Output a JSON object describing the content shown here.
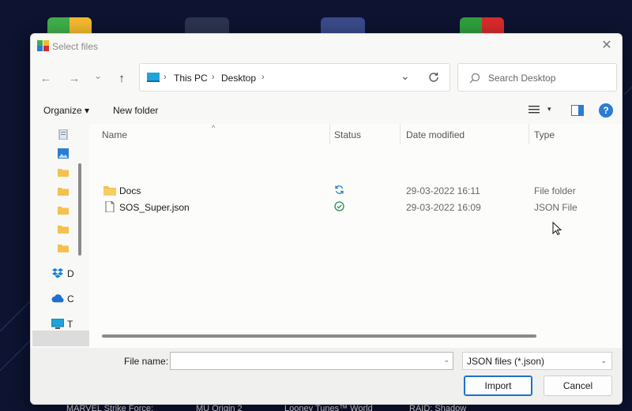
{
  "desktop": {
    "labels": [
      "MARVEL Strike Force:",
      "MU Origin 2",
      "Looney Tunes™ World",
      "RAID: Shadow"
    ]
  },
  "dialog": {
    "title": "Select files",
    "close_symbol": "✕"
  },
  "nav": {
    "back_symbol": "←",
    "forward_symbol": "→",
    "recent_symbol": "⌄",
    "up_symbol": "↑"
  },
  "address": {
    "crumbs": [
      "This PC",
      "Desktop"
    ],
    "separator": "›",
    "dropdown_symbol": "⌄"
  },
  "search": {
    "placeholder": "Search Desktop"
  },
  "toolbar": {
    "organize_label": "Organize ▾",
    "new_folder_label": "New folder",
    "view_drop_symbol": "▾",
    "help_symbol": "?"
  },
  "navpane": {
    "items": [
      {
        "icon": "document-icon",
        "label": ""
      },
      {
        "icon": "pictures-icon",
        "label": ""
      },
      {
        "icon": "folder-icon",
        "label": ""
      },
      {
        "icon": "folder-icon",
        "label": ""
      },
      {
        "icon": "folder-icon",
        "label": ""
      },
      {
        "icon": "folder-icon",
        "label": ""
      },
      {
        "icon": "folder-icon",
        "label": ""
      },
      {
        "icon": "dropbox-icon",
        "label": "D"
      },
      {
        "icon": "onedrive-icon",
        "label": "C"
      },
      {
        "icon": "this-pc-icon",
        "label": "T"
      },
      {
        "icon": "desktop-icon",
        "label": ""
      }
    ]
  },
  "files": {
    "columns": {
      "name": "Name",
      "status": "Status",
      "date": "Date modified",
      "type": "Type"
    },
    "sort_symbol": "^",
    "rows": [
      {
        "name": "Docs",
        "icon": "folder-icon",
        "status_icon": "sync-icon",
        "date": "29-03-2022 16:11",
        "type": "File folder"
      },
      {
        "name": "SOS_Super.json",
        "icon": "file-icon",
        "status_icon": "synced-check-icon",
        "date": "29-03-2022 16:09",
        "type": "JSON File"
      }
    ]
  },
  "footer": {
    "filename_label": "File name:",
    "filename_value": "",
    "filter_label": "JSON files (*.json)",
    "dropdown_symbol": "⌄",
    "import_label": "Import",
    "cancel_label": "Cancel"
  },
  "colors": {
    "accent": "#1b72c9",
    "folder": "#f2c14e",
    "sync_blue": "#2b7cd3",
    "synced_green": "#2e8b57",
    "desktop_bg": "#0d1330"
  }
}
